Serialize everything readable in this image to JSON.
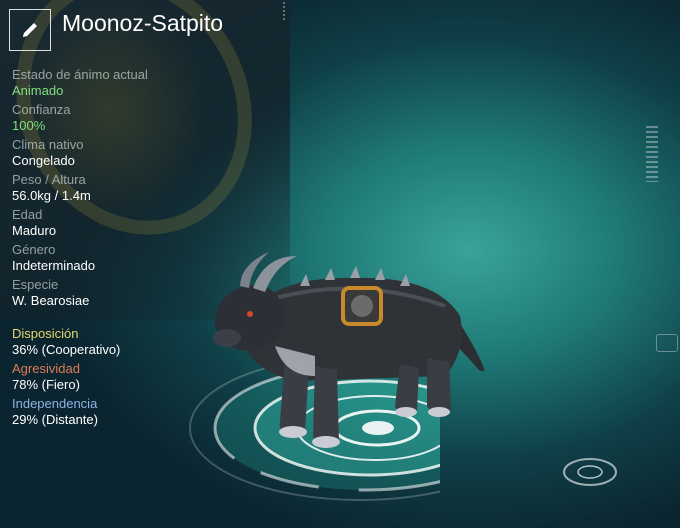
{
  "title": "Moonoz-Satpito",
  "stats": [
    {
      "label": "Estado de ánimo actual",
      "value": "Animado"
    },
    {
      "label": "Confianza",
      "value": "100%"
    },
    {
      "label": "Clima nativo",
      "value": "Congelado"
    },
    {
      "label": "Peso / Altura",
      "value": "56.0kg / 1.4m"
    },
    {
      "label": "Edad",
      "value": "Maduro"
    },
    {
      "label": "Género",
      "value": "Indeterminado"
    },
    {
      "label": "Especie",
      "value": "W. Bearosiae"
    }
  ],
  "traits": [
    {
      "label": "Disposición",
      "value": "36% (Cooperativo)",
      "level": 0.36,
      "color": "#e2d76a"
    },
    {
      "label": "Agresividad",
      "value": "78% (Fiero)",
      "level": 0.78,
      "color": "#e07a5a"
    },
    {
      "label": "Independencia",
      "value": "29% (Distante)",
      "level": 0.29,
      "color": "#8fb2e6"
    }
  ],
  "icons": {
    "edit": "pencil-icon"
  },
  "colors": {
    "positive_value": "#7fe07f",
    "accent_teal": "#2fa396"
  }
}
